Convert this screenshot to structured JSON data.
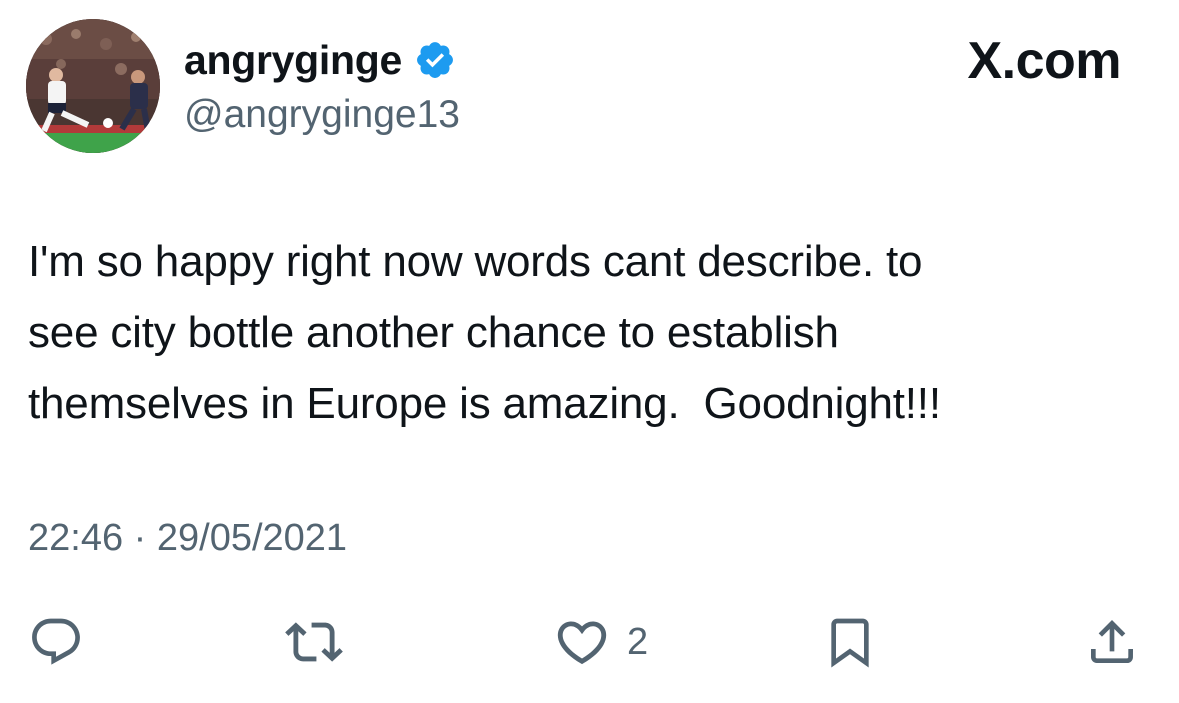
{
  "brand": {
    "label": "X.com"
  },
  "author": {
    "display_name": "angryginge",
    "handle": "@angryginge13",
    "verified": true,
    "verified_color": "#1d9bf0"
  },
  "tweet": {
    "text": "I'm so happy right now words cant describe. to\nsee city bottle another chance to establish\nthemselves in Europe is amazing.  Goodnight!!!",
    "time": "22:46",
    "separator": "·",
    "date": "29/05/2021"
  },
  "actions": {
    "reply": {
      "icon": "reply-icon",
      "count": ""
    },
    "retweet": {
      "icon": "retweet-icon",
      "count": ""
    },
    "like": {
      "icon": "heart-icon",
      "count": "2"
    },
    "bookmark": {
      "icon": "bookmark-icon",
      "count": ""
    },
    "share": {
      "icon": "share-icon",
      "count": ""
    }
  },
  "colors": {
    "text_primary": "#0f1419",
    "text_secondary": "#536471",
    "background": "#ffffff"
  }
}
